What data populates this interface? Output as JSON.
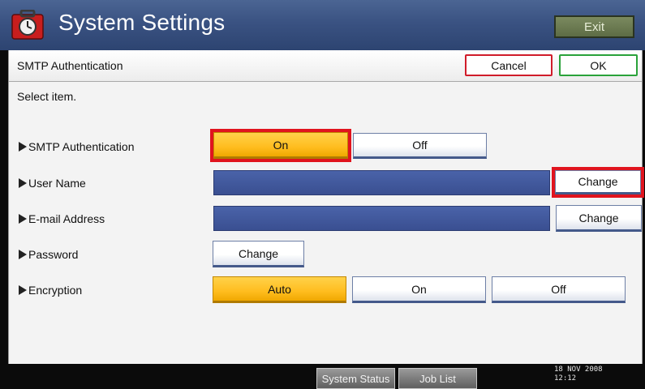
{
  "titlebar": {
    "title": "System Settings",
    "icon": "settings-toolbox-icon",
    "exit_label": "Exit"
  },
  "header": {
    "title": "SMTP Authentication",
    "cancel_label": "Cancel",
    "ok_label": "OK"
  },
  "instruction": "Select item.",
  "rows": [
    {
      "label": "SMTP Authentication",
      "options": [
        "On",
        "Off"
      ],
      "selected": "On"
    },
    {
      "label": "User Name",
      "action_label": "Change"
    },
    {
      "label": "E-mail Address",
      "action_label": "Change"
    },
    {
      "label": "Password",
      "action_label": "Change"
    },
    {
      "label": "Encryption",
      "options": [
        "Auto",
        "On",
        "Off"
      ],
      "selected": "Auto"
    }
  ],
  "statusbar": {
    "system_status_label": "System Status",
    "job_list_label": "Job List",
    "date": "18 NOV  2008",
    "time": "12:12"
  },
  "colors": {
    "titlebar": "#3a5282",
    "selected": "#ffbd1f",
    "highlight_outline": "#e0141e",
    "field_bar": "#3f5699",
    "cancel_border": "#d01c2a",
    "ok_border": "#2aa23a"
  }
}
